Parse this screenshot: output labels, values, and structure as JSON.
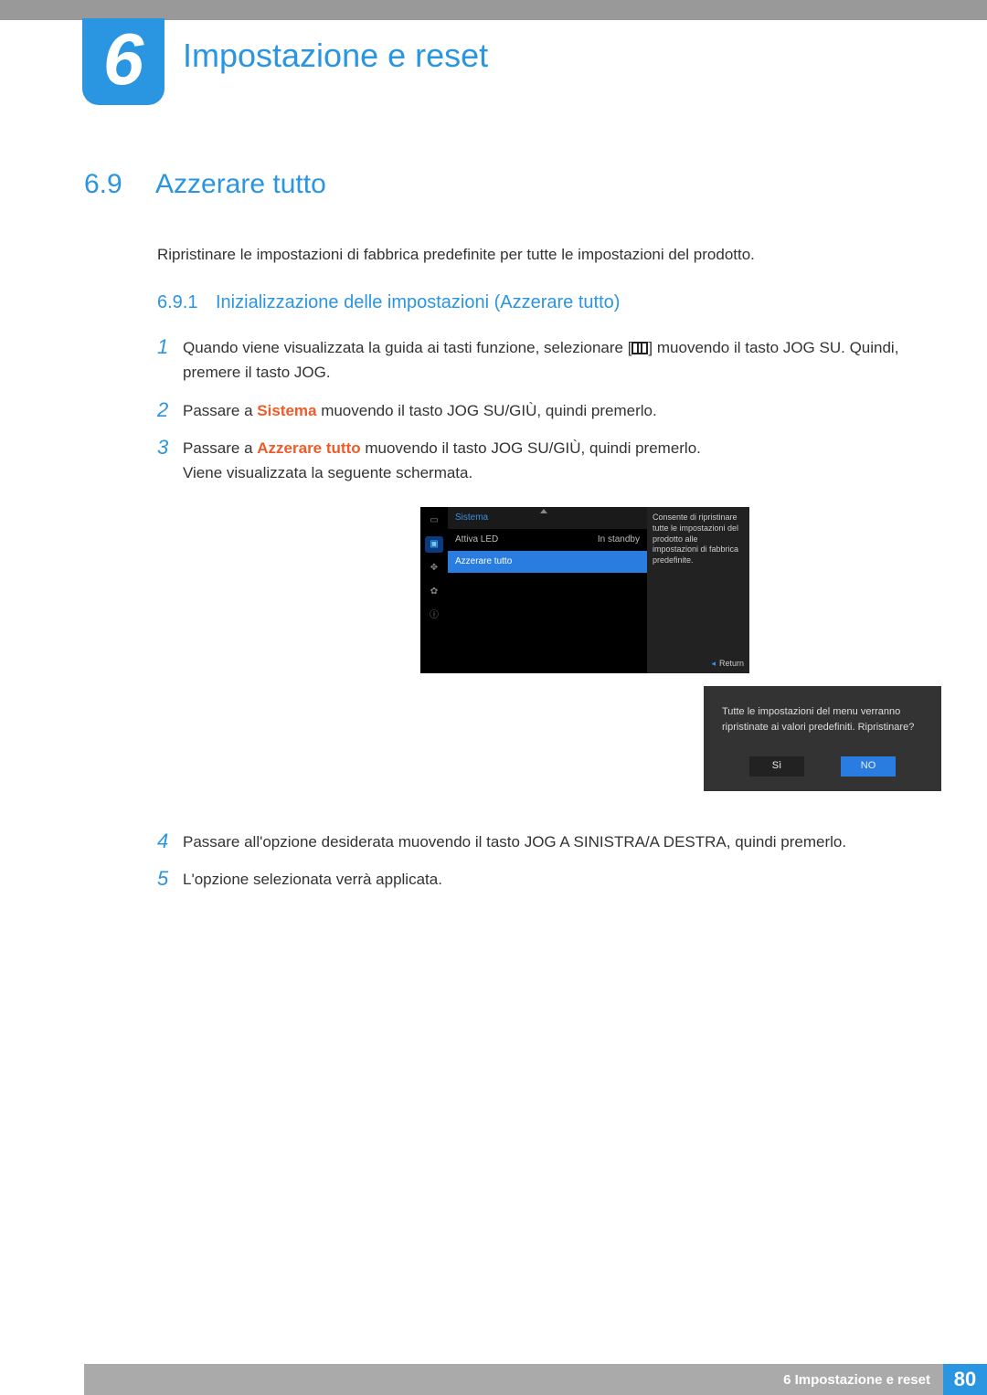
{
  "chapter": {
    "number": "6",
    "title": "Impostazione e reset"
  },
  "section": {
    "number": "6.9",
    "title": "Azzerare tutto",
    "intro": "Ripristinare le impostazioni di fabbrica predefinite per tutte le impostazioni del prodotto."
  },
  "subsection": {
    "number": "6.9.1",
    "title": "Inizializzazione delle impostazioni (Azzerare tutto)"
  },
  "steps": {
    "s1a": "Quando viene visualizzata la guida ai tasti funzione, selezionare [",
    "s1b": "] muovendo il tasto JOG SU. Quindi, premere il tasto JOG.",
    "s2a": "Passare a ",
    "s2kw": "Sistema",
    "s2b": " muovendo il tasto JOG SU/GIÙ, quindi premerlo.",
    "s3a": "Passare a ",
    "s3kw": "Azzerare tutto",
    "s3b": " muovendo il tasto JOG SU/GIÙ, quindi premerlo.",
    "s3c": "Viene visualizzata la seguente schermata.",
    "s4": "Passare all'opzione desiderata muovendo il tasto JOG A SINISTRA/A DESTRA, quindi premerlo.",
    "s5": "L'opzione selezionata verrà applicata."
  },
  "nums": {
    "n1": "1",
    "n2": "2",
    "n3": "3",
    "n4": "4",
    "n5": "5"
  },
  "osd": {
    "header": "Sistema",
    "row1": {
      "label": "Attiva LED",
      "value": "In standby"
    },
    "row2": "Azzerare tutto",
    "desc": "Consente di ripristinare tutte le impostazioni del prodotto alle impostazioni di fabbrica predefinite.",
    "return": "Return"
  },
  "dialog": {
    "text": "Tutte le impostazioni del menu verranno ripristinate ai valori predefiniti. Ripristinare?",
    "yes": "Sì",
    "no": "NO"
  },
  "footer": {
    "title": "6 Impostazione e reset",
    "page": "80"
  }
}
